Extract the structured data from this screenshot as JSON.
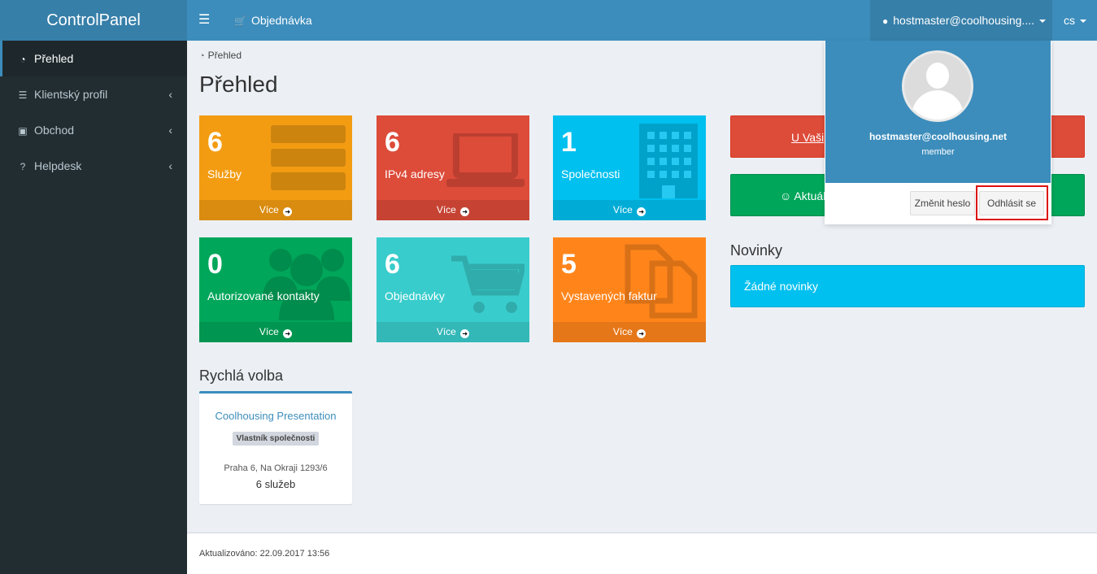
{
  "brand": "ControlPanel",
  "navbar": {
    "order_label": "Objednávka",
    "user_label": "hostmaster@coolhousing....",
    "lang": "cs"
  },
  "sidebar": {
    "items": [
      {
        "label": "Přehled",
        "icon": "dashboard-icon"
      },
      {
        "label": "Klientský profil",
        "icon": "list-icon"
      },
      {
        "label": "Obchod",
        "icon": "money-icon"
      },
      {
        "label": "Helpdesk",
        "icon": "question-icon"
      }
    ]
  },
  "breadcrumb": "Přehled",
  "page_title": "Přehled",
  "tiles": [
    {
      "number": "6",
      "label": "Služby",
      "more": "Více",
      "color": "#f39c12"
    },
    {
      "number": "6",
      "label": "IPv4 adresy",
      "more": "Více",
      "color": "#dd4b39"
    },
    {
      "number": "1",
      "label": "Společnosti",
      "more": "Více",
      "color": "#00c0ef"
    },
    {
      "number": "0",
      "label": "Autorizované kontakty",
      "more": "Více",
      "color": "#00a65a"
    },
    {
      "number": "6",
      "label": "Objednávky",
      "more": "Více",
      "color": "#39cccc"
    },
    {
      "number": "5",
      "label": "Vystavených faktur",
      "more": "Více",
      "color": "#ff851b"
    }
  ],
  "right_buttons": {
    "red_label": "U Vaši",
    "green_label": "☺ Aktuál"
  },
  "news": {
    "heading": "Novinky",
    "empty_text": "Žádné novinky"
  },
  "quick": {
    "heading": "Rychlá volba",
    "company_name": "Coolhousing Presentation",
    "badge": "Vlastník společnosti",
    "address": "Praha 6, Na Okraji 1293/6",
    "services": "6 služeb"
  },
  "footer": {
    "updated": "Aktualizováno: 22.09.2017 13:56"
  },
  "user_dropdown": {
    "email": "hostmaster@coolhousing.net",
    "role": "member",
    "change_password": "Změnit heslo",
    "logout": "Odhlásit se"
  }
}
